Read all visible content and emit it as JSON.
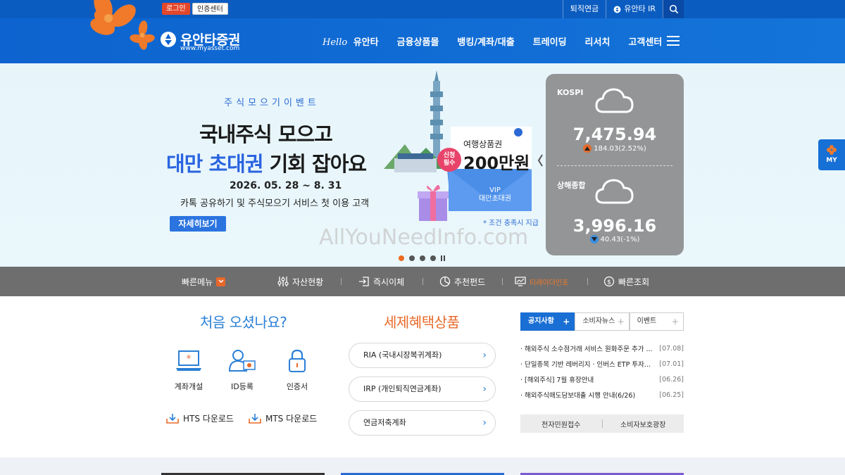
{
  "topbar": {
    "login": "로그인",
    "cert_center": "인증센터",
    "retirement": "퇴직연금",
    "ir": "유안타 IR"
  },
  "header": {
    "logo_text": "유안타증권",
    "logo_sub": "www.myasset.com",
    "nav_hello": "Hello",
    "nav": [
      "유안타",
      "금융상품몰",
      "뱅킹/계좌/대출",
      "트레이딩",
      "리서치",
      "고객센터"
    ]
  },
  "hero": {
    "event_tag": "주식모으기이벤트",
    "title_line1": "국내주식 모으고",
    "title_line2_highlight": "대만 초대권",
    "title_line2_rest": " 기회 잡아요",
    "date": "2026. 05. 28 ~ 8. 31",
    "description": "카톡 공유하기 및 주식모으기 서비스 첫 이용 고객",
    "button": "자세히보기",
    "voucher_label": "여행상품권",
    "voucher_amount": "200만원",
    "badge": "신청\n필수",
    "vip": "VIP",
    "vip_sub": "대만초대권",
    "condition_note": "* 조건 충족시 지급",
    "watermark": "AllYouNeedInfo.com"
  },
  "indices": [
    {
      "name": "KOSPI",
      "value": "7,475.94",
      "change": "184.03(2.52%)",
      "direction": "up"
    },
    {
      "name": "상해종합",
      "value": "3,996.16",
      "change": "40.43(-1%)",
      "direction": "down"
    }
  ],
  "my_tab": "MY",
  "quick_menu": {
    "title": "빠른메뉴",
    "items": [
      "자산현황",
      "즉시이체",
      "추천펀드",
      "티레이더인포",
      "빠른조회"
    ]
  },
  "first_visit": {
    "title": "처음 오셨나요?",
    "services": [
      "계좌개설",
      "ID등록",
      "인증서"
    ],
    "downloads": [
      "HTS 다운로드",
      "MTS 다운로드"
    ]
  },
  "tax_products": {
    "title": "세제혜택상품",
    "items": [
      "RIA (국내시장복귀계좌)",
      "IRP (개인퇴직연금계좌)",
      "연금저축계좌"
    ]
  },
  "notice": {
    "tabs": [
      "공지사항",
      "소비자뉴스",
      "이벤트"
    ],
    "items": [
      {
        "title": "· 해외주식 소수점거래 서비스 원화주문 추가 ...",
        "date": "[07.08]"
      },
      {
        "title": "· 단일종목 기반 레버리지 · 인버스 ETP 투자...",
        "date": "[07.01]"
      },
      {
        "title": "· [해외주식] 7월 휴장안내",
        "date": "[06.26]"
      },
      {
        "title": "· 해외주식매도담보대출 시행 안내(6/26)",
        "date": "[06.25]"
      }
    ],
    "links": [
      "전자민원접수",
      "소비자보호광장"
    ]
  },
  "colors": {
    "brand_blue": "#0d63cf",
    "accent_orange": "#e86a2a",
    "index_card": "#939596",
    "quick_bar": "#6e6e6e"
  }
}
